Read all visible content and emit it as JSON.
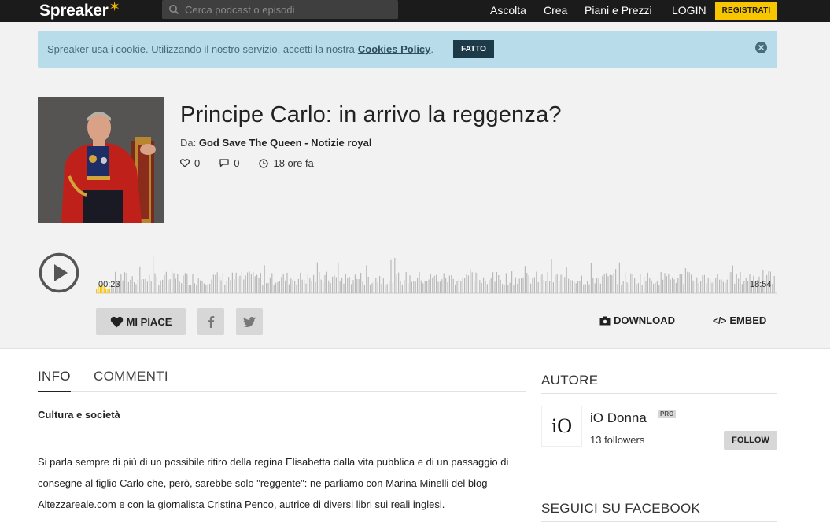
{
  "brand": {
    "logo_text": "Spreaker",
    "star_glyph": "✶",
    "accent": "#f7c600"
  },
  "search": {
    "placeholder": "Cerca podcast o episodi"
  },
  "nav": {
    "ascolta": "Ascolta",
    "crea": "Crea",
    "piani": "Piani e Prezzi",
    "login": "LOGIN",
    "registrati": "REGISTRATI"
  },
  "cookie": {
    "text": "Spreaker usa i cookie. Utilizzando il nostro servizio, accetti la nostra",
    "link": "Cookies Policy",
    "dot": ".",
    "button": "FATTO"
  },
  "episode": {
    "title": "Principe Carlo: in arrivo la reggenza?",
    "by_label": "Da:",
    "show_name": "God Save The Queen - Notizie royal",
    "likes": "0",
    "comments": "0",
    "time_ago": "18 ore fa"
  },
  "player": {
    "current_time": "00:23",
    "total_time": "18:54",
    "progress_fraction": 0.02
  },
  "actions": {
    "like": "MI PIACE",
    "download": "DOWNLOAD",
    "embed": "EMBED",
    "embed_glyph": "</>"
  },
  "tabs": {
    "info": "INFO",
    "commenti": "COMMENTI"
  },
  "content": {
    "category": "Cultura e società",
    "description": "Si parla sempre di più di un possibile ritiro della regina Elisabetta dalla vita pubblica e di un passaggio di consegne al figlio Carlo che, però, sarebbe solo \"reggente\": ne parliamo con Marina Minelli del blog Altezzareale.com e con la giornalista Cristina Penco, autrice di diversi libri sui reali inglesi."
  },
  "sidebar": {
    "autore_heading": "AUTORE",
    "author_name": "iO Donna",
    "author_logo": "iO",
    "pro_badge": "PRO",
    "followers": "13 followers",
    "follow_button": "FOLLOW",
    "facebook_heading": "SEGUICI SU FACEBOOK"
  }
}
